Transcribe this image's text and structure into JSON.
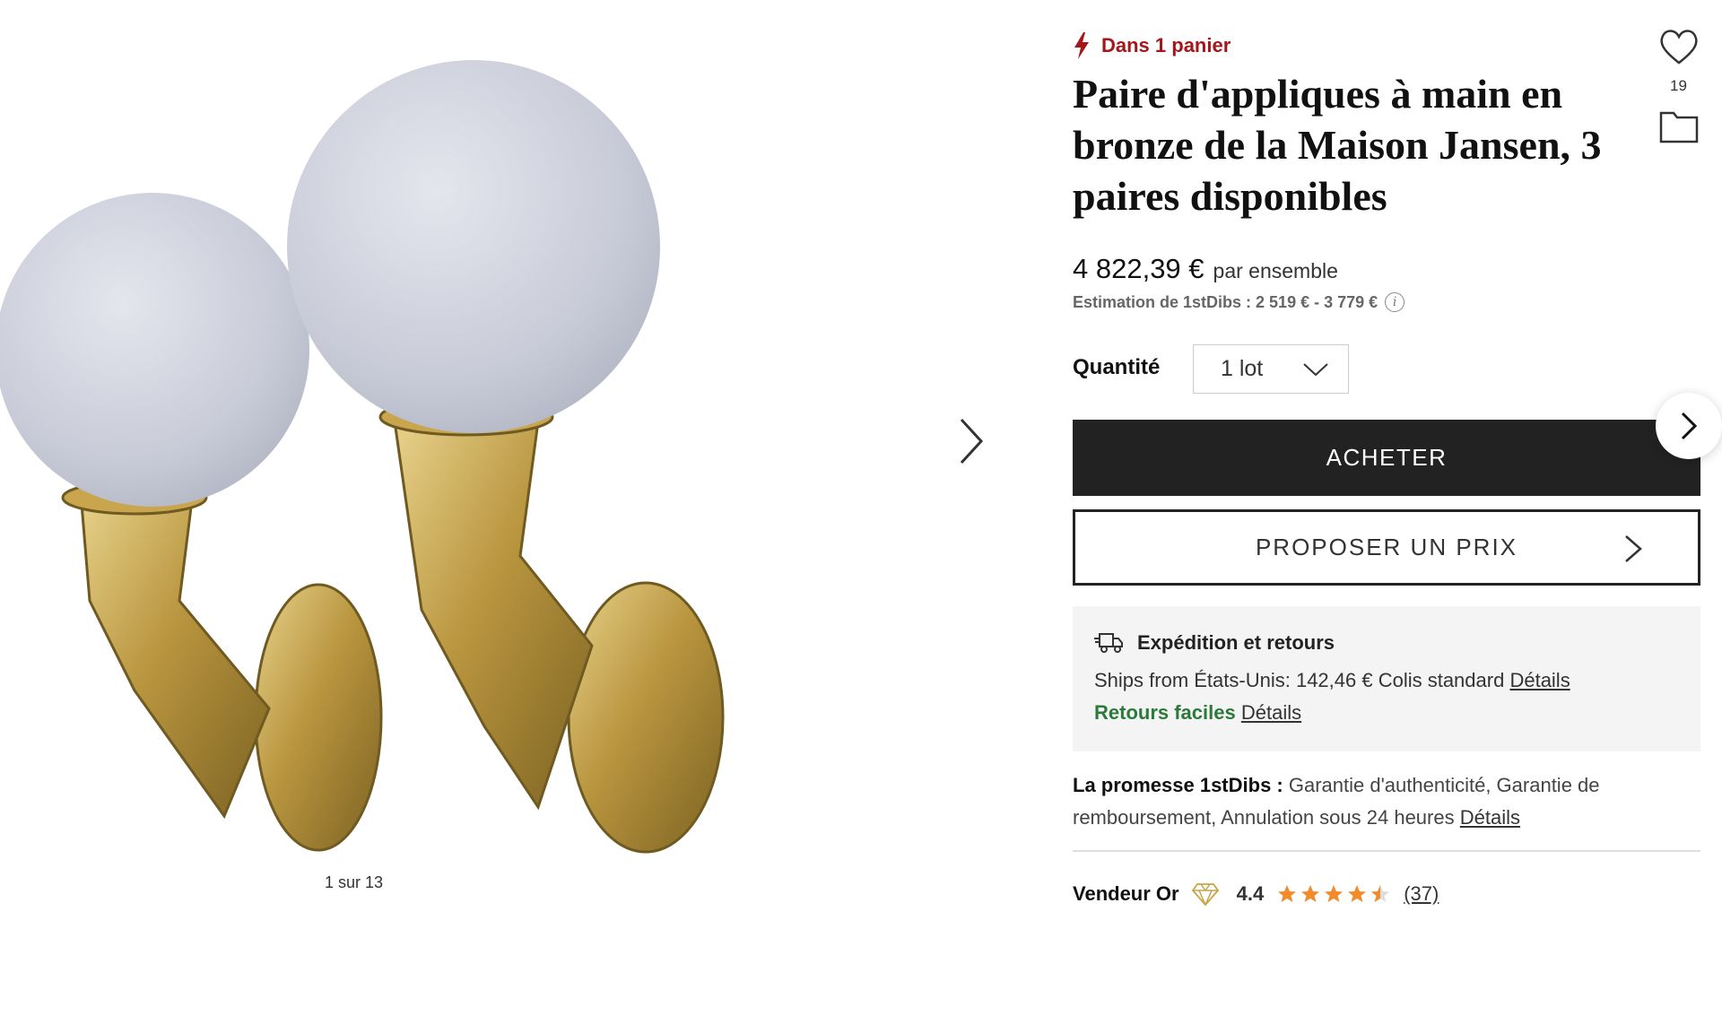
{
  "gallery": {
    "counter": "1 sur 13",
    "image_subject": "pair-of-bronze-hand-sconces-with-glass-globes",
    "next_icon": "chevron-right-icon"
  },
  "product": {
    "cart_notice": "Dans 1 panier",
    "cart_icon": "lightning-icon",
    "title": "Paire d'appliques à main en bronze de la Maison Jansen, 3 paires disponibles",
    "price": "4 822,39 €",
    "price_unit": "par ensemble",
    "estimate": "Estimation de 1stDibs : 2 519 € - 3 779 €",
    "favorites_count": "19"
  },
  "quantity": {
    "label": "Quantité",
    "selected": "1 lot"
  },
  "actions": {
    "buy": "ACHETER",
    "offer": "PROPOSER UN PRIX"
  },
  "shipping": {
    "heading": "Expédition et retours",
    "ships_from": "Ships from États-Unis: 142,46 € Colis standard",
    "ships_details": "Détails",
    "returns": "Retours faciles",
    "returns_details": "Détails"
  },
  "promise": {
    "label": "La promesse 1stDibs :",
    "text": "Garantie d'authenticité, Garantie de remboursement, Annulation sous 24 heures",
    "details": "Détails"
  },
  "seller": {
    "label": "Vendeur Or",
    "rating": "4.4",
    "reviews": "(37)",
    "rating_fraction": 0.88
  },
  "colors": {
    "accent_red": "#a4161a",
    "green": "#2b7a3a",
    "star": "#f08c2b",
    "buy_bg": "#222222"
  }
}
